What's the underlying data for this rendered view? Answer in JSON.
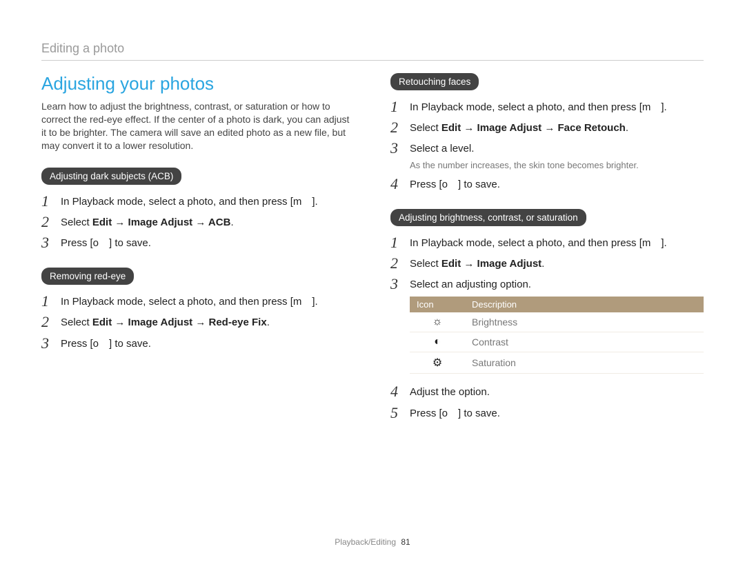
{
  "header": {
    "section": "Editing a photo"
  },
  "left": {
    "title": "Adjusting your photos",
    "intro": "Learn how to adjust the brightness, contrast, or saturation or how to correct the red-eye effect. If the center of a photo is dark, you can adjust it to be brighter. The camera will save an edited photo as a new file, but may convert it to a lower resolution.",
    "acb": {
      "pill": "Adjusting dark subjects (ACB)",
      "s1": "In Playback mode, select a photo, and then press [m ].",
      "s2a": "Select ",
      "s2b": "Edit → Image Adjust → ACB",
      "s2c": ".",
      "s3": "Press [o ] to save."
    },
    "redeye": {
      "pill": "Removing red-eye",
      "s1": "In Playback mode, select a photo, and then press [m ].",
      "s2a": "Select ",
      "s2b": "Edit → Image Adjust → Red-eye Fix",
      "s2c": ".",
      "s3": "Press [o ] to save."
    }
  },
  "right": {
    "retouch": {
      "pill": "Retouching faces",
      "s1": "In Playback mode, select a photo, and then press [m ].",
      "s2a": "Select ",
      "s2b": "Edit → Image Adjust → Face Retouch",
      "s2c": ".",
      "s3": "Select a level.",
      "note": "As the number increases, the skin tone becomes brighter.",
      "s4": "Press [o ] to save."
    },
    "bcs": {
      "pill": "Adjusting brightness, contrast, or saturation",
      "s1": "In Playback mode, select a photo, and then press [m ].",
      "s2a": "Select ",
      "s2b": "Edit → Image Adjust",
      "s2c": ".",
      "s3": "Select an adjusting option.",
      "table": {
        "h1": "Icon",
        "h2": "Description",
        "rows": [
          {
            "icon": "☼",
            "desc": "Brightness"
          },
          {
            "icon": "◐",
            "desc": "Contrast"
          },
          {
            "icon": "⚙",
            "desc": "Saturation"
          }
        ]
      },
      "s4": "Adjust the option.",
      "s5": "Press [o ] to save."
    }
  },
  "footer": {
    "label": "Playback/Editing",
    "page": "81"
  }
}
